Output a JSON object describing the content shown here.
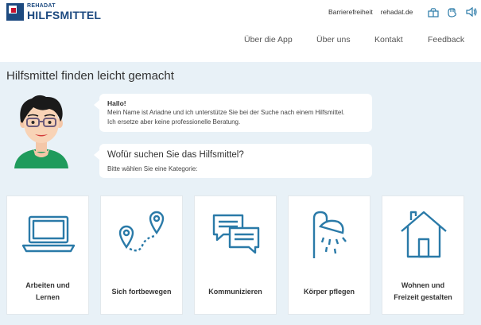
{
  "header": {
    "logo_small": "REHADAT",
    "logo_big": "HILFSMITTEL",
    "meta_links": [
      "Barrierefreiheit",
      "rehadat.de"
    ],
    "meta_icons": [
      "easy-language-icon",
      "sign-language-icon",
      "speaker-icon"
    ]
  },
  "nav": {
    "items": [
      "Über die App",
      "Über uns",
      "Kontakt",
      "Feedback"
    ]
  },
  "main": {
    "title": "Hilfsmittel finden leicht gemacht",
    "bubble1": {
      "greeting": "Hallo!",
      "line1": "Mein Name ist Ariadne und ich unterstütze Sie bei der Suche nach einem Hilfsmittel.",
      "line2": "Ich ersetze aber keine professionelle Beratung."
    },
    "bubble2": {
      "question": "Wofür suchen Sie das Hilfsmittel?",
      "sub": "Bitte wählen Sie eine Kategorie:"
    },
    "categories": [
      {
        "label_line1": "Arbeiten und",
        "label_line2": "Lernen",
        "icon": "laptop-icon"
      },
      {
        "label_line1": "Sich fortbewegen",
        "label_line2": "",
        "icon": "route-icon"
      },
      {
        "label_line1": "Kommunizieren",
        "label_line2": "",
        "icon": "chat-icon"
      },
      {
        "label_line1": "Körper pflegen",
        "label_line2": "",
        "icon": "shower-icon"
      },
      {
        "label_line1": "Wohnen und",
        "label_line2": "Freizeit gestalten",
        "icon": "house-icon"
      }
    ]
  },
  "colors": {
    "brand": "#1d4a80",
    "accent_red": "#c8102e",
    "icon_blue": "#2a7aa8",
    "content_bg": "#e8f1f7"
  }
}
